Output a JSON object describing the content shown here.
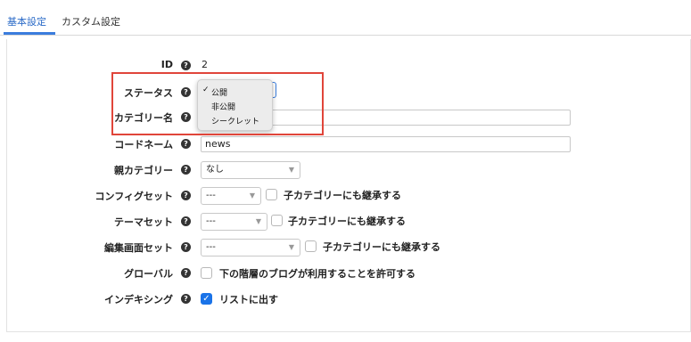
{
  "tabs": [
    {
      "label": "基本設定",
      "active": true
    },
    {
      "label": "カスタム設定",
      "active": false
    }
  ],
  "help_glyph": "?",
  "fields": {
    "id": {
      "label": "ID",
      "value": "2"
    },
    "status": {
      "label": "ステータス",
      "options": [
        "公開",
        "非公開",
        "シークレット"
      ],
      "selected": "公開",
      "check_glyph": "✓"
    },
    "category_name": {
      "label": "カテゴリー名",
      "value": ""
    },
    "code_name": {
      "label": "コードネーム",
      "value": "news"
    },
    "parent_category": {
      "label": "親カテゴリー",
      "value": "なし"
    },
    "config_set": {
      "label": "コンフィグセット",
      "value": "---",
      "inherit_label": "子カテゴリーにも継承する",
      "inherit_checked": false
    },
    "theme_set": {
      "label": "テーマセット",
      "value": "---",
      "inherit_label": "子カテゴリーにも継承する",
      "inherit_checked": false
    },
    "edit_screen_set": {
      "label": "編集画面セット",
      "value": "---",
      "inherit_label": "子カテゴリーにも継承する",
      "inherit_checked": false
    },
    "global": {
      "label": "グローバル",
      "checkbox_label": "下の階層のブログが利用することを許可する",
      "checked": false
    },
    "indexing": {
      "label": "インデキシング",
      "checkbox_label": "リストに出す",
      "checked": true
    }
  },
  "colors": {
    "accent": "#3b7ddd",
    "highlight": "#e0453a",
    "checkbox_on": "#1a73e8"
  }
}
